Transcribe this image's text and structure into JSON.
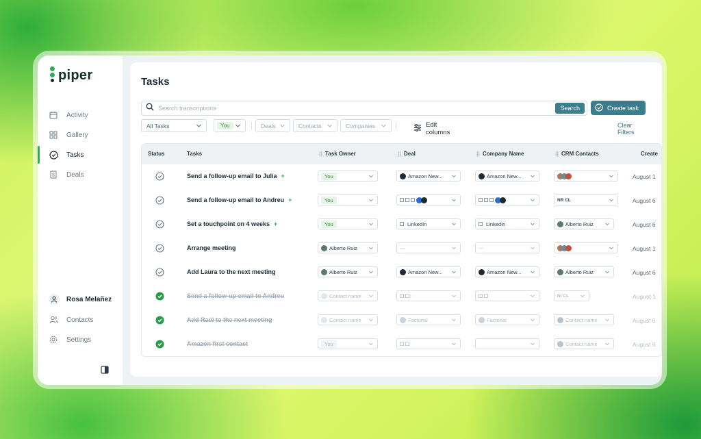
{
  "app": {
    "name": "piper"
  },
  "sidebar": {
    "nav": [
      {
        "label": "Activity",
        "icon": "calendar-icon"
      },
      {
        "label": "Gallery",
        "icon": "grid-icon"
      },
      {
        "label": "Tasks",
        "icon": "check-circle-icon",
        "active": true
      },
      {
        "label": "Deals",
        "icon": "dollar-doc-icon"
      }
    ],
    "user": {
      "name": "Rosa Melañez",
      "icon": "user-icon"
    },
    "bottom": [
      {
        "label": "Contacts",
        "icon": "users-icon"
      },
      {
        "label": "Settings",
        "icon": "gear-icon"
      }
    ]
  },
  "page": {
    "title": "Tasks"
  },
  "search": {
    "placeholder": "Search transcriptions",
    "button": "Search"
  },
  "create_task": "Create task",
  "filters": {
    "all_tasks": "All Tasks",
    "owner": "You",
    "deals": "Deals",
    "contacts": "Contacts",
    "companies": "Companies",
    "edit_columns": "Edit columns",
    "clear": "Clear Filters"
  },
  "table": {
    "columns": [
      "Status",
      "Tasks",
      "Task Owner",
      "Deal",
      "Company Name",
      "CRM Contacts",
      "Create"
    ],
    "rows": [
      {
        "done": false,
        "task": "Send a follow-up email to Julia",
        "sparkle": "+",
        "owner": "You",
        "deal": "Amazon New...",
        "company": "Amazon New...",
        "contacts": "",
        "date": "August 1"
      },
      {
        "done": false,
        "task": "Send a follow-up email to Andreu",
        "sparkle": "+",
        "owner": "You",
        "deal": "",
        "company": "",
        "contacts": "NR CL",
        "date": "August 6"
      },
      {
        "done": false,
        "task": "Set a touchpoint on 4 weeks",
        "sparkle": "+",
        "owner": "You",
        "deal": "LinkedIn",
        "company": "LinkedIn",
        "contacts": "Alberto Ruiz",
        "date": "August 6"
      },
      {
        "done": false,
        "task": "Arrange meeting",
        "owner": "Alberto Ruiz",
        "deal": "---",
        "company": "---",
        "contacts": "",
        "date": "August 1"
      },
      {
        "done": false,
        "task": "Add Laura to the next meeting",
        "owner": "Alberto Ruiz",
        "deal": "Amazon New...",
        "company": "Amazon New...",
        "contacts": "Alberto Ruiz",
        "date": "August 6"
      },
      {
        "done": true,
        "task": "Send a follow-up email to Andreu",
        "owner": "Contact name",
        "deal": "",
        "company": "",
        "contacts": "NI CL",
        "date": "August 1"
      },
      {
        "done": true,
        "task": "Add Raúl to the next meeting",
        "owner": "Contact name",
        "deal": "Factorial",
        "company": "Factorial",
        "contacts": "Contact name",
        "date": "August 6"
      },
      {
        "done": true,
        "task": "Amazon first contact",
        "owner": "You",
        "deal": "",
        "company": "",
        "contacts": "Contact name",
        "date": "August 6"
      }
    ]
  },
  "colors": {
    "accent": "#3a7d8c",
    "green": "#2fae5a",
    "done_green": "#2a9d4a"
  }
}
